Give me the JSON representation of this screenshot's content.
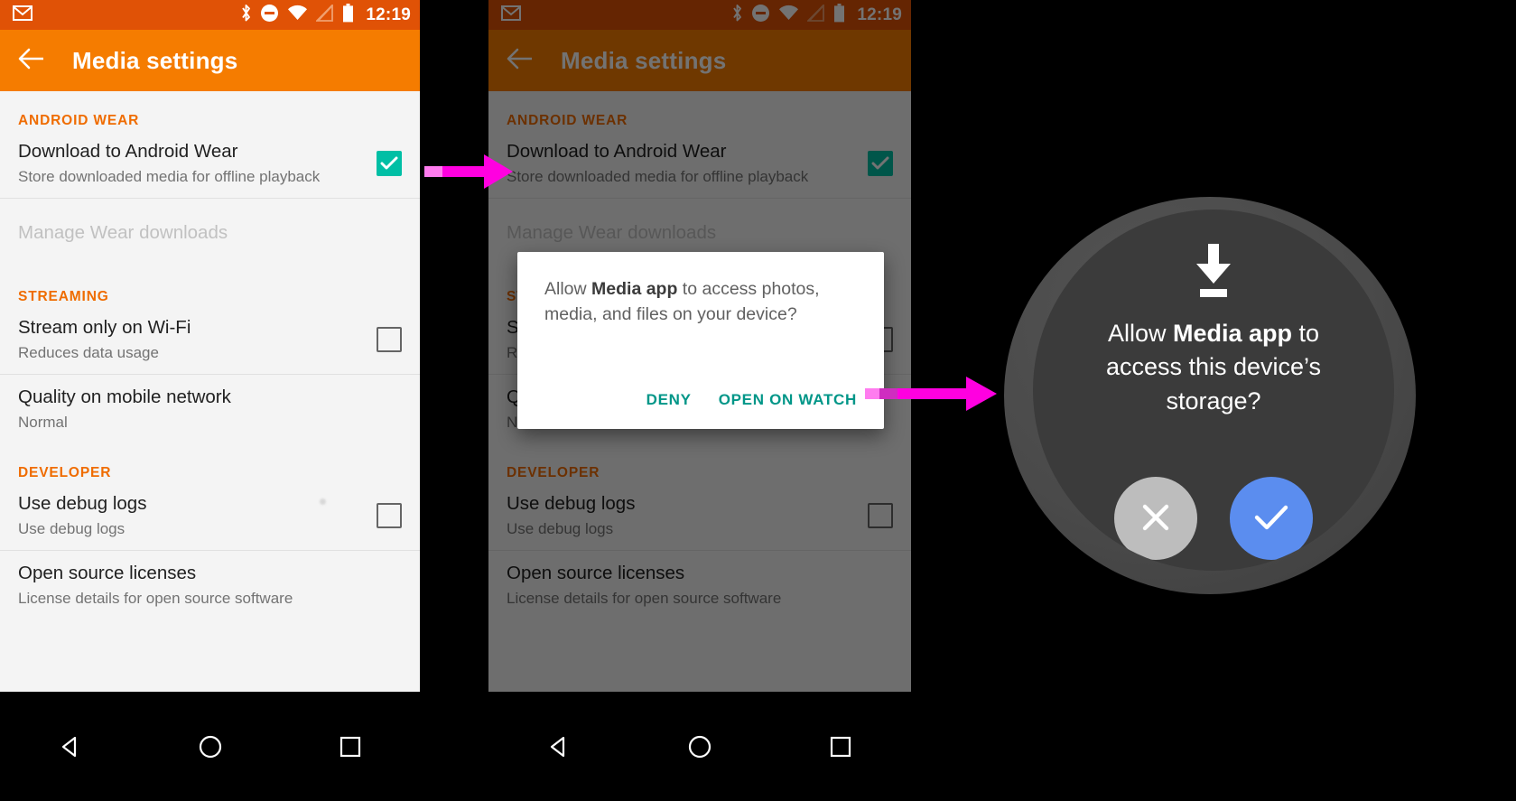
{
  "statusbar": {
    "gmail_icon": "gmail-icon",
    "bluetooth_icon": "bluetooth-icon",
    "dnd_icon": "do-not-disturb-icon",
    "wifi_icon": "wifi-icon",
    "signal_off_icon": "cell-signal-off-icon",
    "battery_icon": "battery-icon",
    "time": "12:19"
  },
  "appbar": {
    "back_icon": "back-arrow-icon",
    "title": "Media settings"
  },
  "settings": {
    "sections": [
      {
        "header": "ANDROID WEAR",
        "rows": [
          {
            "title": "Download to Android Wear",
            "subtitle": "Store downloaded media for offline playback",
            "checkbox": "checked"
          },
          {
            "title": "Manage Wear downloads",
            "subtitle": "",
            "checkbox": "none",
            "state": "disabled"
          }
        ]
      },
      {
        "header": "STREAMING",
        "rows": [
          {
            "title": "Stream only on Wi-Fi",
            "subtitle": "Reduces data usage",
            "checkbox": "unchecked"
          },
          {
            "title": "Quality on mobile network",
            "subtitle": "Normal",
            "checkbox": "none"
          }
        ]
      },
      {
        "header": "DEVELOPER",
        "rows": [
          {
            "title": "Use debug logs",
            "subtitle": "Use debug logs",
            "checkbox": "unchecked"
          },
          {
            "title": "Open source licenses",
            "subtitle": "License details for open source software",
            "checkbox": "none"
          }
        ]
      }
    ]
  },
  "navbar": {
    "back_icon": "nav-back-triangle-icon",
    "home_icon": "nav-home-circle-icon",
    "recents_icon": "nav-recents-square-icon"
  },
  "dialog": {
    "message_prefix": "Allow ",
    "message_app": "Media app",
    "message_suffix": " to access photos, media, and files on your device?",
    "deny_label": "DENY",
    "confirm_label": "OPEN ON WATCH",
    "accent_color": "#009688"
  },
  "watch": {
    "download_icon": "download-icon",
    "message_prefix": "Allow ",
    "message_app": "Media app",
    "message_suffix": " to access this device’s storage?",
    "deny_icon": "close-x-icon",
    "allow_icon": "check-icon",
    "deny_color": "#BDBDBD",
    "allow_color": "#5B8DEF"
  },
  "arrows": {
    "arrow1": "flow-arrow-right-icon",
    "arrow2": "flow-arrow-right-icon",
    "color": "#FF00E0"
  }
}
